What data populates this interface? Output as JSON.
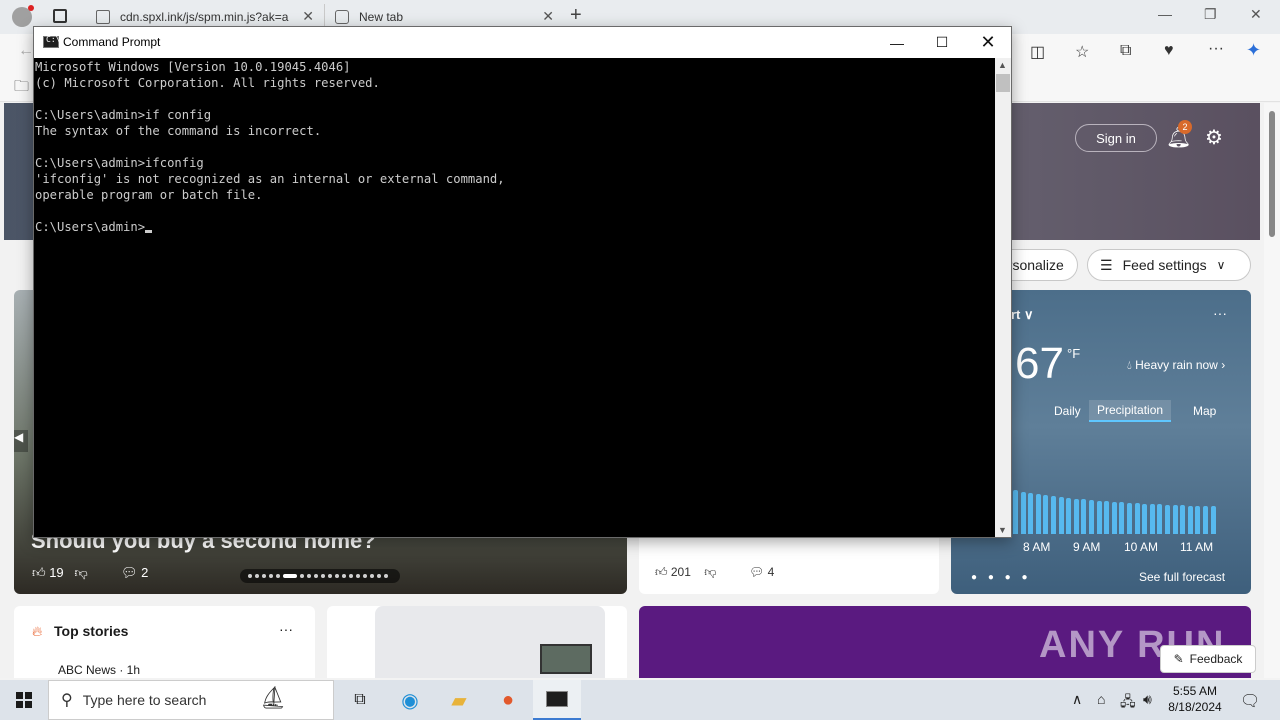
{
  "browser": {
    "tabs": [
      {
        "label": "cdn.spxl.ink/js/spm.min.js?ak=a"
      },
      {
        "label": "New tab"
      }
    ],
    "new_tab_symbol": "+",
    "close_symbol": "✕"
  },
  "ntp": {
    "sign_in": "Sign in",
    "notification_count": "2",
    "personalize": "ersonalize",
    "feed_settings": "Feed settings",
    "hero": {
      "title": "Should you buy a second home?",
      "likes": "19",
      "comments": "2"
    },
    "mid_card": {
      "likes": "201",
      "comments": "4"
    },
    "weather": {
      "location": "rt",
      "temperature": "67",
      "unit": "°F",
      "condition": "Heavy rain now",
      "tabs": [
        "Daily",
        "Precipitation",
        "Map"
      ],
      "times": [
        "8 AM",
        "9 AM",
        "10 AM",
        "11 AM"
      ],
      "see_full": "See full forecast"
    },
    "top_stories": {
      "title": "Top stories",
      "source": "ABC News · 1h"
    },
    "promo": {
      "watermark": "ANY RUN"
    },
    "feedback": "Feedback"
  },
  "cmd": {
    "title": "Command Prompt",
    "lines": [
      "Microsoft Windows [Version 10.0.19045.4046]",
      "(c) Microsoft Corporation. All rights reserved.",
      "",
      "C:\\Users\\admin>if config",
      "The syntax of the command is incorrect.",
      "",
      "C:\\Users\\admin>ifconfig",
      "'ifconfig' is not recognized as an internal or external command,",
      "operable program or batch file.",
      ""
    ],
    "prompt": "C:\\Users\\admin>"
  },
  "taskbar": {
    "search_placeholder": "Type here to search",
    "time": "5:55 AM",
    "date": "8/18/2024"
  },
  "colors": {
    "cmd_bg": "#000000",
    "cmd_text": "#cccccc",
    "taskbar_bg": "#dde3ea",
    "accent": "#3c7bd1"
  }
}
